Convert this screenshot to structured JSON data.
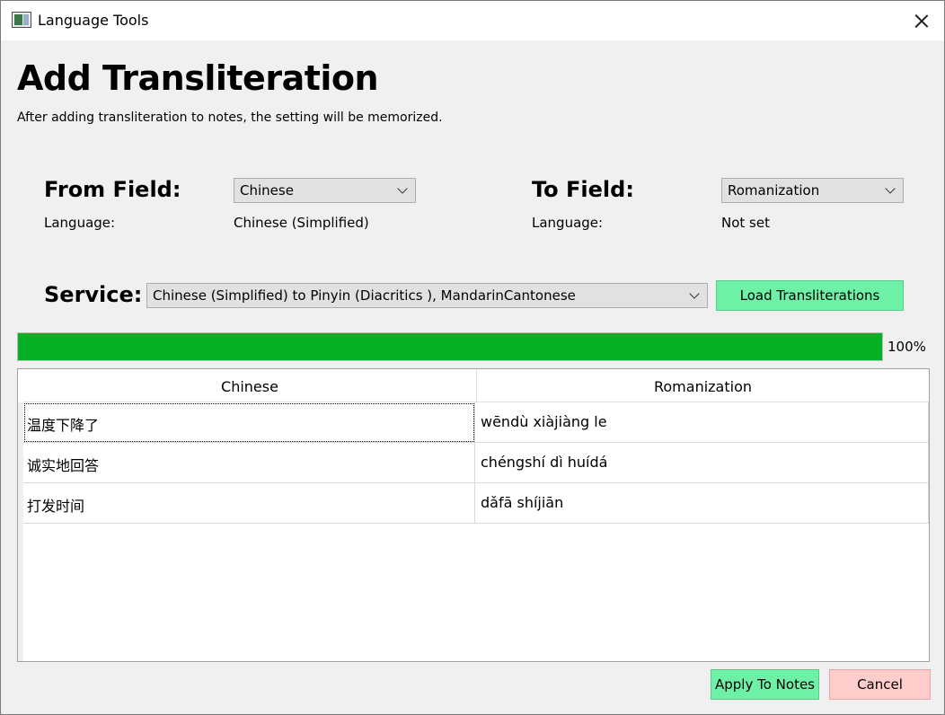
{
  "window": {
    "title": "Language Tools",
    "icon": "app-window-icon",
    "close_icon": "close-icon"
  },
  "header": {
    "title": "Add Transliteration",
    "subtitle": "After adding transliteration to notes, the setting will be memorized."
  },
  "from_field": {
    "label": "From Field:",
    "selected": "Chinese",
    "language_label": "Language:",
    "language_value": "Chinese (Simplified)"
  },
  "to_field": {
    "label": "To Field:",
    "selected": "Romanization",
    "language_label": "Language:",
    "language_value": "Not set"
  },
  "service": {
    "label": "Service:",
    "selected": "Chinese (Simplified) to Pinyin (Diacritics ), MandarinCantonese",
    "load_button": "Load Transliterations"
  },
  "progress": {
    "value": 100,
    "label": "100%"
  },
  "table": {
    "headers": [
      "Chinese",
      "Romanization"
    ],
    "rows": [
      [
        "温度下降了",
        "wēndù xiàjiàng le"
      ],
      [
        "诚实地回答",
        "chéngshí dì huídá"
      ],
      [
        "打发时间",
        "dǎfā shíjiān"
      ]
    ]
  },
  "footer": {
    "apply_button": "Apply To Notes",
    "cancel_button": "Cancel"
  },
  "colors": {
    "accent_green": "#6ff0a7",
    "progress_green": "#06b025",
    "cancel_pink": "#ffcccc"
  }
}
